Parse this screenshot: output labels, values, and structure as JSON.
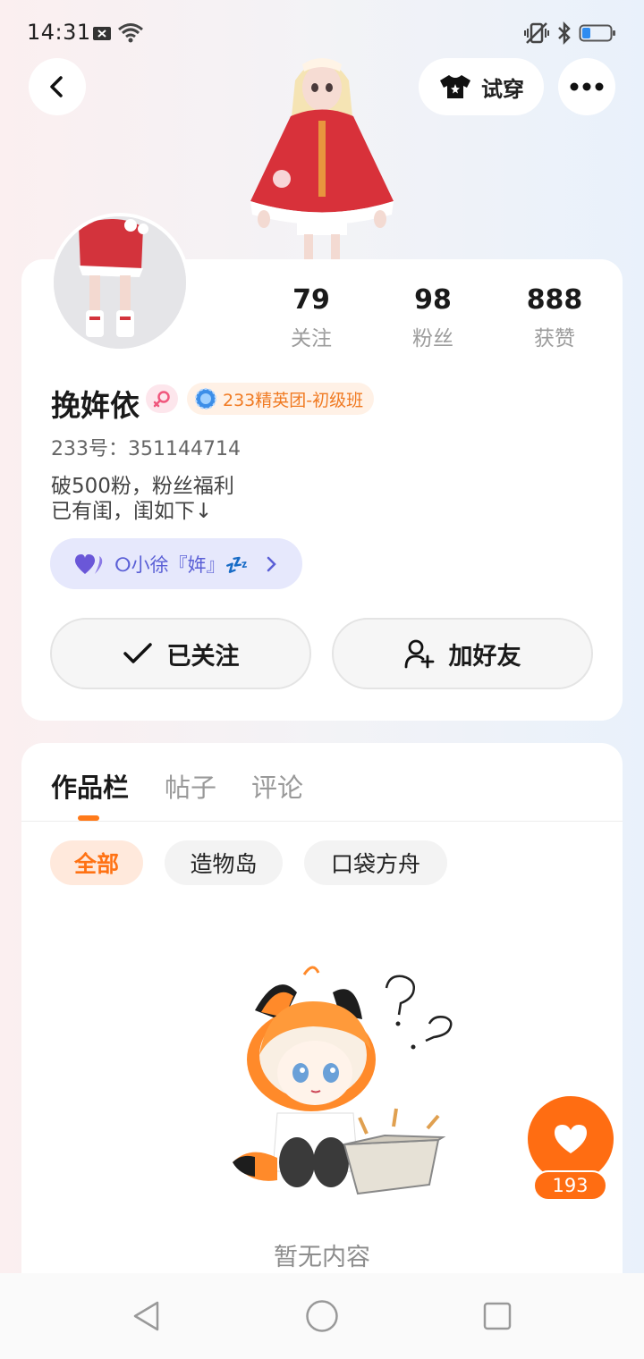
{
  "status_bar": {
    "time": "14:31",
    "icons": [
      "notification-x-icon",
      "wifi-icon",
      "vibrate-icon",
      "bluetooth-icon",
      "battery-icon"
    ],
    "battery_level": 0.25
  },
  "top_bar": {
    "back_icon": "chevron-left-icon",
    "try_on_label": "试穿",
    "try_on_icon": "shirt-icon",
    "more_icon": "more-icon"
  },
  "profile": {
    "stats": [
      {
        "value": "79",
        "label": "关注"
      },
      {
        "value": "98",
        "label": "粉丝"
      },
      {
        "value": "888",
        "label": "获赞"
      }
    ],
    "username": "挽姩依",
    "gender": "female",
    "level_badge": "233精英团-初级班",
    "uid": "233号：351144714",
    "bio_line1": "破500粉，粉丝福利",
    "bio_line2": "已有闺，闺如下↓",
    "cp_name": "ⵔ小徐『姩』💤",
    "follow_button": "已关注",
    "add_friend_button": "加好友"
  },
  "content": {
    "tabs": [
      {
        "label": "作品栏",
        "active": true
      },
      {
        "label": "帖子",
        "active": false
      },
      {
        "label": "评论",
        "active": false
      }
    ],
    "filters": [
      {
        "label": "全部",
        "active": true
      },
      {
        "label": "造物岛",
        "active": false
      },
      {
        "label": "口袋方舟",
        "active": false
      }
    ],
    "empty_text": "暂无内容"
  },
  "like_fab": {
    "count": "193"
  },
  "colors": {
    "accent": "#ff6d12",
    "cp_purple": "#5a5fd6",
    "level_orange": "#f07a22"
  }
}
